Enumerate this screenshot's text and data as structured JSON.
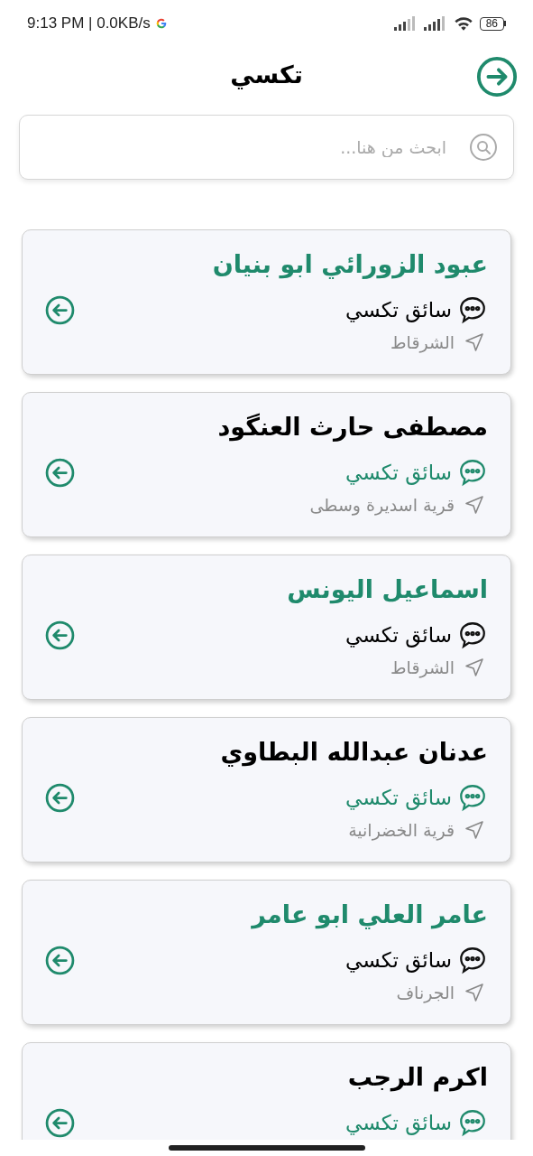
{
  "status_bar": {
    "time": "9:13 PM | 0.0KB/s",
    "battery": "86"
  },
  "header": {
    "title": "تكسي"
  },
  "search": {
    "placeholder": "ابحث من هنا..."
  },
  "drivers": [
    {
      "name": "عبود الزورائي ابو بنيان",
      "role": "سائق تكسي",
      "location": "الشرقاط",
      "name_highlighted": true,
      "role_highlighted": false
    },
    {
      "name": "مصطفى حارث العنگود",
      "role": "سائق تكسي",
      "location": "قرية اسديرة وسطى",
      "name_highlighted": false,
      "role_highlighted": true
    },
    {
      "name": "اسماعيل اليونس",
      "role": "سائق تكسي",
      "location": "الشرقاط",
      "name_highlighted": true,
      "role_highlighted": false
    },
    {
      "name": "عدنان عبدالله البطاوي",
      "role": "سائق تكسي",
      "location": "قرية الخضرانية",
      "name_highlighted": false,
      "role_highlighted": true
    },
    {
      "name": "عامر العلي ابو عامر",
      "role": "سائق تكسي",
      "location": "الجرناف",
      "name_highlighted": true,
      "role_highlighted": false
    },
    {
      "name": "اكرم الرجب",
      "role": "سائق تكسي",
      "name_highlighted": false,
      "role_highlighted": true
    }
  ]
}
